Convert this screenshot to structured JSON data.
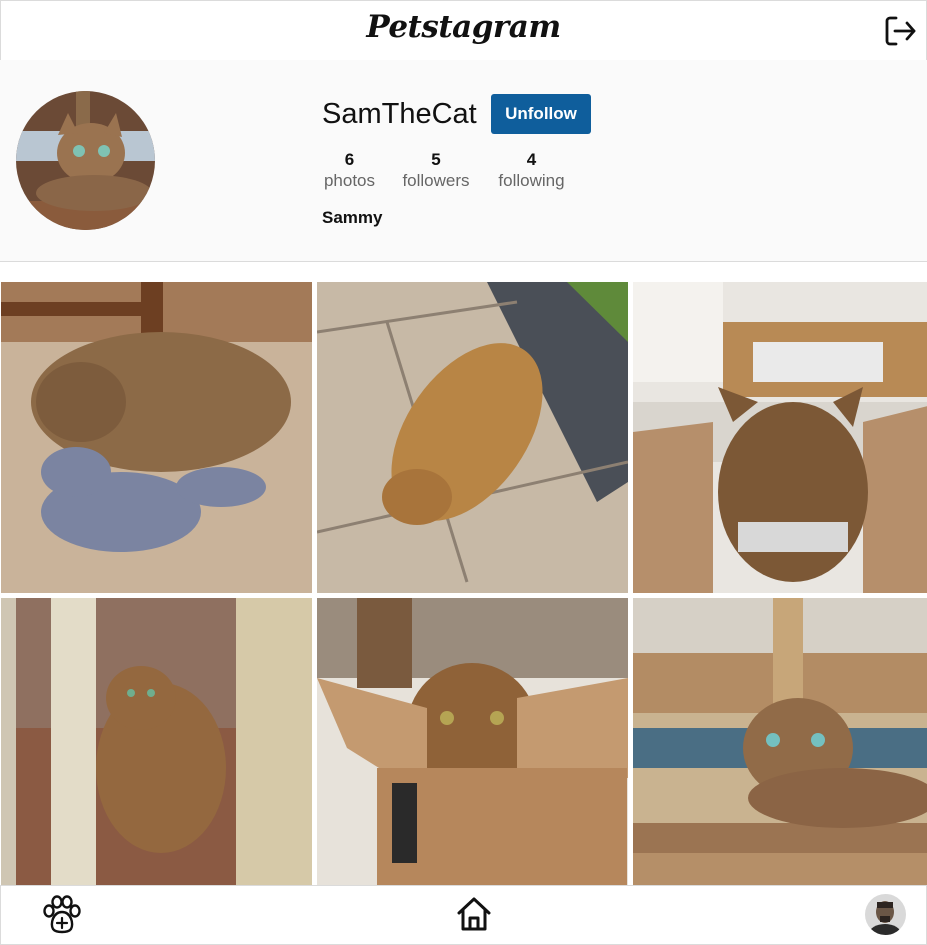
{
  "app": {
    "name": "Petstagram"
  },
  "header": {
    "logout_icon": "logout-icon"
  },
  "profile": {
    "username": "SamTheCat",
    "follow_button_label": "Unfollow",
    "follow_button_color": "#0f5e9c",
    "stats": [
      {
        "value": "6",
        "label": "photos"
      },
      {
        "value": "5",
        "label": "followers"
      },
      {
        "value": "4",
        "label": "following"
      }
    ],
    "full_name": "Sammy"
  },
  "photos": [
    {
      "description": "tabby cat sleeping on wooden floor hugging a grey stuffed toy"
    },
    {
      "description": "tabby cat lying on its back on a stone patio"
    },
    {
      "description": "tabby cat seen from behind sitting in a cardboard box"
    },
    {
      "description": "tabby cat standing in a glass doorway"
    },
    {
      "description": "tabby cat peeking out of a cardboard box"
    },
    {
      "description": "tabby cat resting on a wooden deck step"
    }
  ],
  "nav": {
    "add_icon": "paw-plus-icon",
    "home_icon": "home-icon",
    "profile_icon": "user-avatar"
  }
}
